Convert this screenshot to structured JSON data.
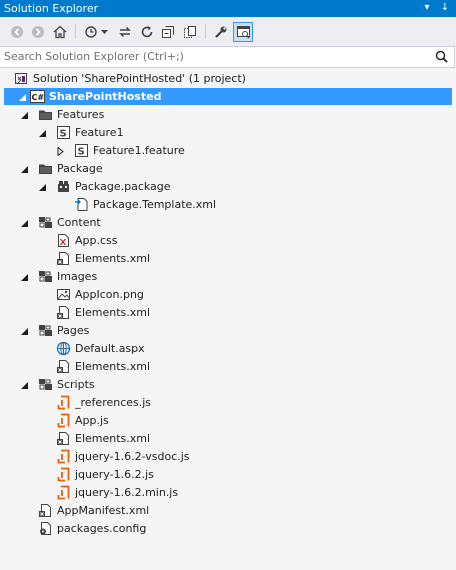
{
  "window": {
    "title": "Solution Explorer",
    "pin_glyph": "↓",
    "dropdown_glyph": "▾"
  },
  "toolbar": {
    "buttons": [
      {
        "name": "back-icon"
      },
      {
        "name": "forward-icon"
      },
      {
        "name": "home-icon"
      },
      {
        "name": "history-icon"
      },
      {
        "name": "sync-icon"
      },
      {
        "name": "refresh-icon"
      },
      {
        "name": "collapse-all-icon"
      },
      {
        "name": "show-all-files-icon"
      },
      {
        "name": "properties-icon"
      },
      {
        "name": "preview-icon"
      }
    ]
  },
  "search": {
    "placeholder": "Search Solution Explorer (Ctrl+;)",
    "value": ""
  },
  "tree": [
    {
      "label": "Solution 'SharePointHosted' (1 project)",
      "icon": "solution-icon",
      "level": 0,
      "expander": "none"
    },
    {
      "label": "SharePointHosted",
      "icon": "csharp-project-icon",
      "level": 0,
      "expander": "expanded",
      "selected": true
    },
    {
      "label": "Features",
      "icon": "folder-icon",
      "level": 1,
      "expander": "expanded"
    },
    {
      "label": "Feature1",
      "icon": "sharepoint-feature-icon",
      "level": 2,
      "expander": "expanded"
    },
    {
      "label": "Feature1.feature",
      "icon": "sharepoint-feature-icon",
      "level": 3,
      "expander": "collapsed"
    },
    {
      "label": "Package",
      "icon": "folder-icon",
      "level": 1,
      "expander": "expanded"
    },
    {
      "label": "Package.package",
      "icon": "package-icon",
      "level": 2,
      "expander": "expanded"
    },
    {
      "label": "Package.Template.xml",
      "icon": "template-xml-icon",
      "level": 3,
      "expander": "none"
    },
    {
      "label": "Content",
      "icon": "sharepoint-module-icon",
      "level": 1,
      "expander": "expanded"
    },
    {
      "label": "App.css",
      "icon": "css-file-icon",
      "level": 2,
      "expander": "none"
    },
    {
      "label": "Elements.xml",
      "icon": "xml-file-icon",
      "level": 2,
      "expander": "none"
    },
    {
      "label": "Images",
      "icon": "sharepoint-module-icon",
      "level": 1,
      "expander": "expanded"
    },
    {
      "label": "AppIcon.png",
      "icon": "image-file-icon",
      "level": 2,
      "expander": "none"
    },
    {
      "label": "Elements.xml",
      "icon": "xml-file-icon",
      "level": 2,
      "expander": "none"
    },
    {
      "label": "Pages",
      "icon": "sharepoint-module-icon",
      "level": 1,
      "expander": "expanded"
    },
    {
      "label": "Default.aspx",
      "icon": "aspx-file-icon",
      "level": 2,
      "expander": "none"
    },
    {
      "label": "Elements.xml",
      "icon": "xml-file-icon",
      "level": 2,
      "expander": "none"
    },
    {
      "label": "Scripts",
      "icon": "sharepoint-module-icon",
      "level": 1,
      "expander": "expanded"
    },
    {
      "label": "_references.js",
      "icon": "js-file-icon",
      "level": 2,
      "expander": "none"
    },
    {
      "label": "App.js",
      "icon": "js-file-icon",
      "level": 2,
      "expander": "none"
    },
    {
      "label": "Elements.xml",
      "icon": "xml-file-icon",
      "level": 2,
      "expander": "none"
    },
    {
      "label": "jquery-1.6.2-vsdoc.js",
      "icon": "js-file-icon",
      "level": 2,
      "expander": "none"
    },
    {
      "label": "jquery-1.6.2.js",
      "icon": "js-file-icon",
      "level": 2,
      "expander": "none"
    },
    {
      "label": "jquery-1.6.2.min.js",
      "icon": "js-file-icon",
      "level": 2,
      "expander": "none"
    },
    {
      "label": "AppManifest.xml",
      "icon": "xml-file-icon",
      "level": 1,
      "expander": "none"
    },
    {
      "label": "packages.config",
      "icon": "config-file-icon",
      "level": 1,
      "expander": "none"
    }
  ],
  "colors": {
    "accent": "#007acc",
    "selection": "#3399ff",
    "background": "#f5f5f5",
    "js_orange": "#e8600c"
  }
}
